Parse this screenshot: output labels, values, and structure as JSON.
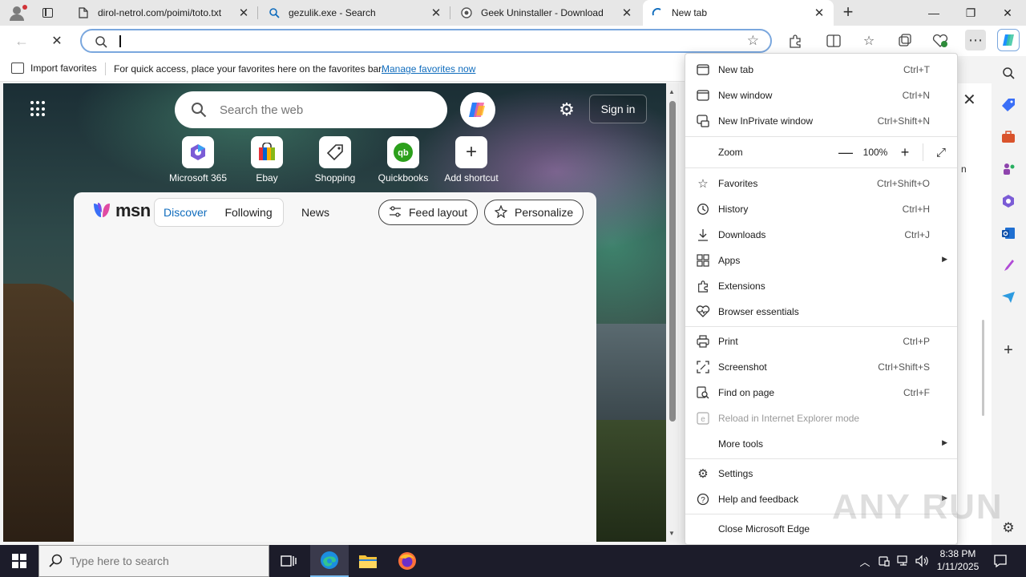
{
  "tabs": [
    {
      "title": "dirol-netrol.com/poimi/toto.txt",
      "icon": "document-icon"
    },
    {
      "title": "gezulik.exe - Search",
      "icon": "search-icon"
    },
    {
      "title": "Geek Uninstaller - Download",
      "icon": "geek-icon"
    },
    {
      "title": "New tab",
      "icon": "loading-icon"
    }
  ],
  "window_controls": {
    "minimize": "—",
    "restore": "❐",
    "close": "✕"
  },
  "address_bar": {
    "value": "",
    "placeholder": ""
  },
  "favorites_bar": {
    "import_label": "Import favorites",
    "hint": "For quick access, place your favorites here on the favorites bar.",
    "manage_link": "Manage favorites now"
  },
  "newtab_page": {
    "search_placeholder": "Search the web",
    "sign_in": "Sign in",
    "shortcuts": [
      {
        "label": "Microsoft 365"
      },
      {
        "label": "Ebay"
      },
      {
        "label": "Shopping"
      },
      {
        "label": "Quickbooks"
      },
      {
        "label": "Add shortcut"
      }
    ],
    "msn": {
      "logo_text": "msn",
      "tabs": [
        "Discover",
        "Following"
      ],
      "selected_tab": "Discover",
      "news": "News",
      "feed_layout": "Feed layout",
      "personalize": "Personalize"
    }
  },
  "side_panel": {
    "fragment": "n"
  },
  "menu": {
    "items": [
      {
        "label": "New tab",
        "shortcut": "Ctrl+T",
        "icon": "new-tab-icon"
      },
      {
        "label": "New window",
        "shortcut": "Ctrl+N",
        "icon": "new-window-icon"
      },
      {
        "label": "New InPrivate window",
        "shortcut": "Ctrl+Shift+N",
        "icon": "inprivate-icon"
      },
      {
        "label": "Zoom",
        "shortcut": "",
        "icon": ""
      },
      {
        "label": "Favorites",
        "shortcut": "Ctrl+Shift+O",
        "icon": "favorites-icon"
      },
      {
        "label": "History",
        "shortcut": "Ctrl+H",
        "icon": "history-icon"
      },
      {
        "label": "Downloads",
        "shortcut": "Ctrl+J",
        "icon": "download-icon"
      },
      {
        "label": "Apps",
        "shortcut": "",
        "icon": "apps-icon",
        "submenu": true
      },
      {
        "label": "Extensions",
        "shortcut": "",
        "icon": "extensions-icon"
      },
      {
        "label": "Browser essentials",
        "shortcut": "",
        "icon": "heart-pulse-icon"
      },
      {
        "label": "Print",
        "shortcut": "Ctrl+P",
        "icon": "print-icon"
      },
      {
        "label": "Screenshot",
        "shortcut": "Ctrl+Shift+S",
        "icon": "screenshot-icon"
      },
      {
        "label": "Find on page",
        "shortcut": "Ctrl+F",
        "icon": "find-icon"
      },
      {
        "label": "Reload in Internet Explorer mode",
        "shortcut": "",
        "icon": "ie-mode-icon",
        "disabled": true
      },
      {
        "label": "More tools",
        "shortcut": "",
        "icon": "",
        "submenu": true
      },
      {
        "label": "Settings",
        "shortcut": "",
        "icon": "gear-icon"
      },
      {
        "label": "Help and feedback",
        "shortcut": "",
        "icon": "help-icon",
        "submenu": true
      },
      {
        "label": "Close Microsoft Edge",
        "shortcut": "",
        "icon": ""
      }
    ],
    "zoom": {
      "minus": "—",
      "value": "100%",
      "plus": "+"
    }
  },
  "watermark": "ANY RUN",
  "taskbar": {
    "search_placeholder": "Type here to search",
    "time": "8:38 PM",
    "date": "1/11/2025"
  },
  "colors": {
    "accent": "#0f6cbd",
    "taskbar": "#1c1c2a",
    "menu_bg": "#ffffff"
  }
}
